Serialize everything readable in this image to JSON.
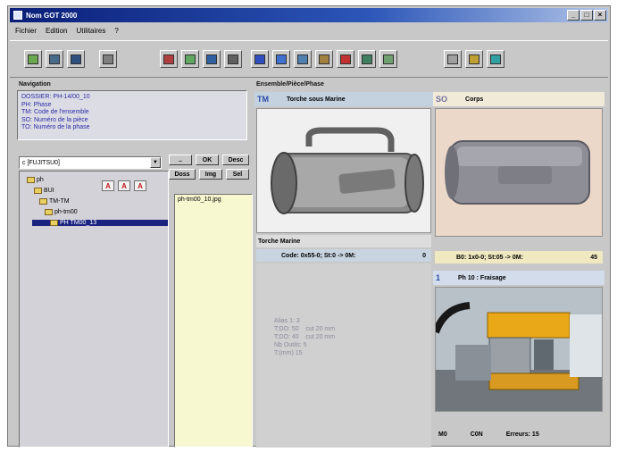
{
  "window": {
    "title": "Nom GOT 2000",
    "min": "_",
    "max": "□",
    "close": "×"
  },
  "menu": [
    "Fichier",
    "Edition",
    "Utilitaires",
    "?"
  ],
  "toolbar_icons": [
    "open-icon",
    "print-icon",
    "save-icon",
    "settings-icon",
    "tool-icon",
    "chart-icon",
    "monitor-icon",
    "print-preview-icon",
    "blue-doc-icon",
    "blue-doc-2-icon",
    "image-icon",
    "photo-icon",
    "person-icon",
    "document-icon",
    "document-2-icon",
    "grid-icon",
    "edit-icon",
    "info-icon"
  ],
  "navigation": {
    "header": "Navigation",
    "lines": [
      "DOSSIER: PH-14/00_10",
      "PH: Phase",
      "TM: Code de l'ensemble",
      "SO: Numéro de la pièce",
      "TO: Numéro de la phase"
    ]
  },
  "path_select": {
    "value": "c [FUJITSU0]"
  },
  "tree": {
    "nodes": [
      "ph",
      "BUI",
      "TM-TM",
      "ph-tm00",
      "PH TM00_13"
    ],
    "selected": "PH TM00_13"
  },
  "list_buttons": {
    "up": "..",
    "ok": "OK",
    "desc": "Desc",
    "dossier": "Doss",
    "image": "Img",
    "sel": "Sel"
  },
  "red_buttons": [
    "A",
    "A",
    "A"
  ],
  "files": [
    "ph-tm00_10.jpg"
  ],
  "center": {
    "header": "Ensemble/Pièce/Phase",
    "code": "TM",
    "title": "Torche sous Marine",
    "caption": "Torche Marine",
    "code_line": "Code: 0x55-0; St:0 -> 0M:",
    "code_value": "0",
    "meta": [
      "Alias 1: 3",
      "T:DO: 50    cut 20 mm",
      "T:DO: 40    cut 20 mm",
      "Nb Outils: 5",
      "T:(mm) 15"
    ]
  },
  "right_top": {
    "code": "SO",
    "title": "Corps",
    "code_line": "B0: 1x0-0; St:05 -> 0M:",
    "code_value": "45"
  },
  "right_bottom": {
    "code": "1",
    "title": "Ph 10 : Fraisage",
    "footer": [
      "M0",
      "C0N",
      "Erreurs: 15"
    ]
  }
}
